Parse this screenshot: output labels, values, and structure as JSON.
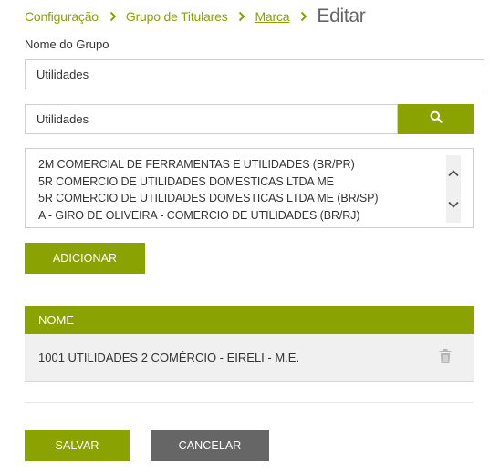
{
  "breadcrumb": {
    "items": [
      "Configuração",
      "Grupo de Titulares",
      "Marca"
    ],
    "current": "Editar"
  },
  "group_name": {
    "label": "Nome do Grupo",
    "value": "Utilidades"
  },
  "search": {
    "value": "Utilidades",
    "button_icon": "search-icon"
  },
  "results": [
    "2M COMERCIAL DE FERRAMENTAS E UTILIDADES (BR/PR)",
    "5R COMERCIO DE UTILIDADES DOMESTICAS LTDA ME",
    "5R COMERCIO DE UTILIDADES DOMESTICAS LTDA ME (BR/SP)",
    "A - GIRO DE OLIVEIRA - COMERCIO DE UTILIDADES (BR/RJ)"
  ],
  "add_label": "ADICIONAR",
  "table": {
    "header": "NOME",
    "rows": [
      "1001 UTILIDADES 2 COMÉRCIO - EIRELI - M.E."
    ],
    "row_icon": "trash-icon"
  },
  "actions": {
    "save_label": "SALVAR",
    "cancel_label": "CANCELAR"
  },
  "colors": {
    "accent": "#8aa300",
    "secondary": "#666666",
    "row_background": "#f0f0f0"
  }
}
